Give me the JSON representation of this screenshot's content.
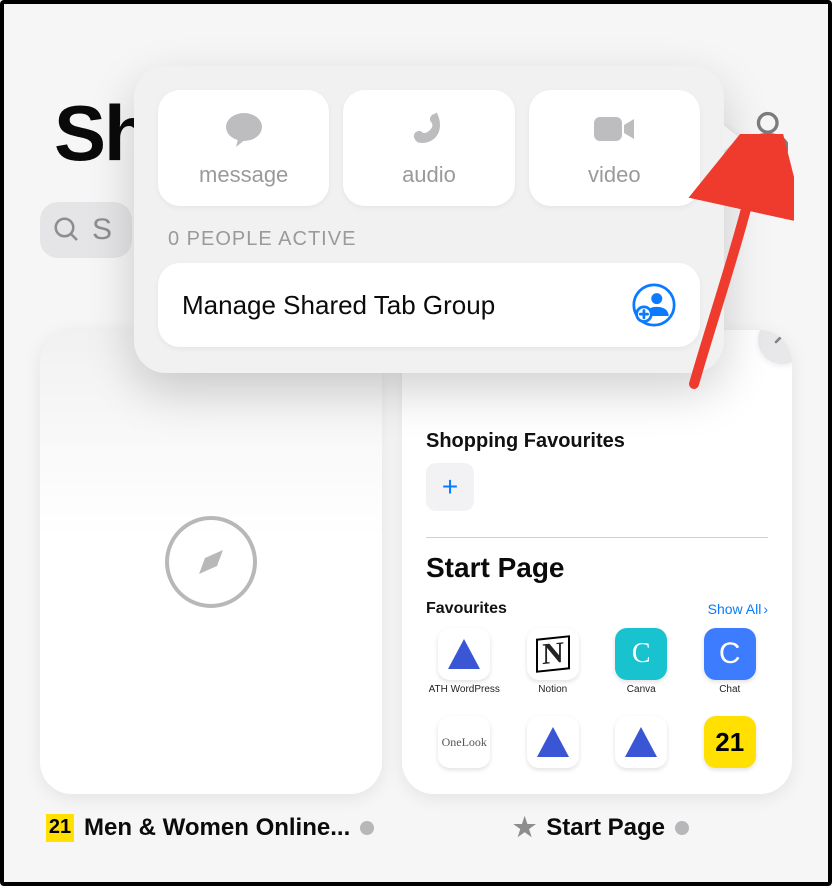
{
  "background": {
    "title_fragment": "Sh",
    "search_fragment": "S",
    "tabs": [
      {
        "caption": "Men & Women Online...",
        "badge_text": "21"
      },
      {
        "caption": "Start Page"
      }
    ]
  },
  "start_page": {
    "shopping_favourites_label": "Shopping  Favourites",
    "title": "Start Page",
    "favourites_label": "Favourites",
    "show_all_label": "Show All",
    "items": [
      {
        "name": "ATH WordPress",
        "kind": "triangle"
      },
      {
        "name": "Notion",
        "kind": "notion"
      },
      {
        "name": "Canva",
        "kind": "canva"
      },
      {
        "name": "Chat",
        "kind": "chat"
      },
      {
        "name": "OneLook",
        "kind": "onelook"
      },
      {
        "name": "",
        "kind": "triangle"
      },
      {
        "name": "",
        "kind": "triangle"
      },
      {
        "name": "",
        "kind": "twentyone"
      }
    ]
  },
  "popover": {
    "actions": [
      {
        "key": "message",
        "label": "message"
      },
      {
        "key": "audio",
        "label": "audio"
      },
      {
        "key": "video",
        "label": "video"
      }
    ],
    "active_label": "0 PEOPLE ACTIVE",
    "manage_label": "Manage Shared Tab Group"
  }
}
